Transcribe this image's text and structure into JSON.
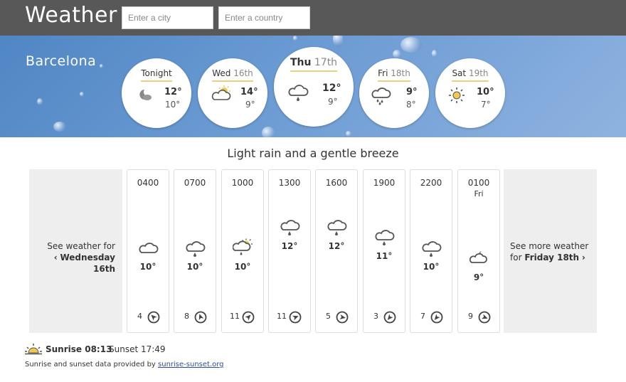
{
  "app": {
    "title": "Weather"
  },
  "search": {
    "city_placeholder": "Enter a city",
    "country_placeholder": "Enter a country"
  },
  "location": {
    "name": "Barcelona"
  },
  "days": [
    {
      "label": "Tonight",
      "num": "",
      "icon": "night-cloud-icon",
      "high": "12°",
      "low": "10°"
    },
    {
      "label": "Wed",
      "num": "16th",
      "icon": "partly-cloudy-icon",
      "high": "14°",
      "low": "9°"
    },
    {
      "label": "Thu",
      "num": "17th",
      "icon": "light-rain-icon",
      "high": "12°",
      "low": "9°"
    },
    {
      "label": "Fri",
      "num": "18th",
      "icon": "rain-icon",
      "high": "9°",
      "low": "8°"
    },
    {
      "label": "Sat",
      "num": "19th",
      "icon": "sun-icon",
      "high": "10°",
      "low": "7°"
    }
  ],
  "summary": "Light rain and a gentle breeze",
  "nav": {
    "prev_line1": "See weather for",
    "prev_line2": "Wednesday 16th",
    "next_line1": "See more weather",
    "next_prefix": "for",
    "next_line2": "Friday 18th"
  },
  "hours": [
    {
      "time": "0400",
      "day": "",
      "icon": "cloud-icon",
      "temp": "10°",
      "wind_speed": "4",
      "wind_icon": "wind-direction-icon"
    },
    {
      "time": "0700",
      "day": "",
      "icon": "light-rain-icon",
      "temp": "10°",
      "wind_speed": "8",
      "wind_icon": "wind-direction-icon"
    },
    {
      "time": "1000",
      "day": "",
      "icon": "partly-cloudy-rain-icon",
      "temp": "10°",
      "wind_speed": "11",
      "wind_icon": "wind-direction-icon"
    },
    {
      "time": "1300",
      "day": "",
      "icon": "light-rain-icon",
      "temp": "12°",
      "wind_speed": "11",
      "wind_icon": "wind-direction-icon"
    },
    {
      "time": "1600",
      "day": "",
      "icon": "light-rain-icon",
      "temp": "12°",
      "wind_speed": "5",
      "wind_icon": "wind-direction-icon"
    },
    {
      "time": "1900",
      "day": "",
      "icon": "light-rain-icon",
      "temp": "11°",
      "wind_speed": "3",
      "wind_icon": "wind-direction-icon"
    },
    {
      "time": "2200",
      "day": "",
      "icon": "light-rain-icon",
      "temp": "10°",
      "wind_speed": "7",
      "wind_icon": "wind-direction-icon"
    },
    {
      "time": "0100",
      "day": "Fri",
      "icon": "night-cloud-icon",
      "temp": "9°",
      "wind_speed": "9",
      "wind_icon": "wind-direction-icon"
    }
  ],
  "sun": {
    "sunrise_label": "Sunrise 08:13",
    "sunset_label": "Sunset 17:49"
  },
  "credit": {
    "text": "Sunrise and sunset data provided by",
    "link": "sunrise-sunset.org"
  },
  "colors": {
    "topbar": "#585858",
    "hero": "#6b9bd3",
    "accent": "#e9d27c",
    "sun": "#f2c94c"
  }
}
